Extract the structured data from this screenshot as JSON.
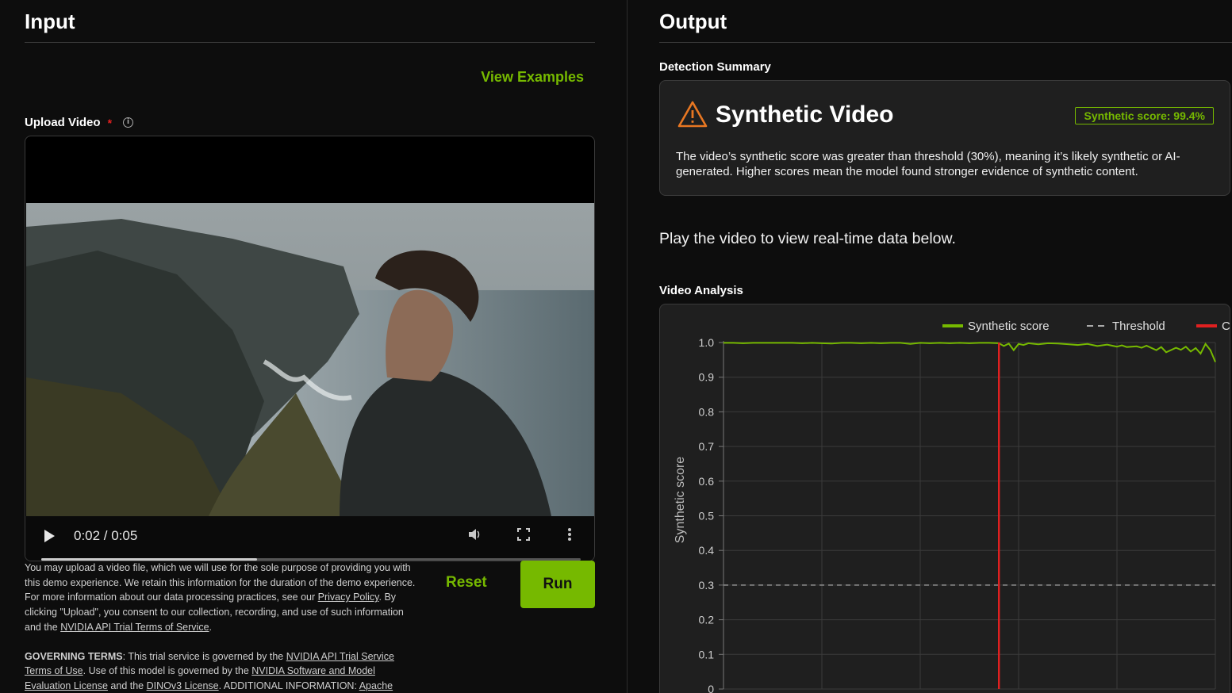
{
  "input": {
    "title": "Input",
    "view_examples": "View Examples",
    "upload_label": "Upload Video",
    "required_mark": "*",
    "info_icon": "info-icon",
    "video": {
      "time": "0:02 / 0:05",
      "progress": 0.4,
      "play_icon": "play-icon",
      "volume_icon": "volume-icon",
      "fullscreen_icon": "fullscreen-icon",
      "more_icon": "more-vertical-icon"
    },
    "disclaimer": {
      "p1_a": "You may upload a video file, which we will use for the sole purpose of providing you with this demo experience. We retain this information for the duration of the demo experience. For more information about our data processing practices, see our ",
      "privacy_link": "Privacy Policy",
      "p1_b": ". By clicking \"Upload\", you consent to our collection, recording, and use of such information and the ",
      "terms_link": "NVIDIA API Trial Terms of Service",
      "p1_c": ".",
      "governing_label": "GOVERNING TERMS",
      "p2_a": ": This trial service is governed by the ",
      "trial_terms_link": "NVIDIA API Trial Service Terms of Use",
      "p2_b": ". Use of this model is governed by the ",
      "software_link": "NVIDIA Software and Model Evaluation License",
      "p2_c": " and the ",
      "dino_link": "DINOv3 License",
      "p2_d": ". ADDITIONAL INFORMATION: ",
      "apache_link": "Apache"
    },
    "reset": "Reset",
    "run": "Run"
  },
  "output": {
    "title": "Output",
    "summary_label": "Detection Summary",
    "result_title": "Synthetic Video",
    "score_badge": "Synthetic score: 99.4%",
    "result_desc": "The video’s synthetic score was greater than threshold (30%), meaning it’s likely synthetic or AI-generated. Higher scores mean the model found stronger evidence of synthetic content.",
    "play_message": "Play the video to view real-time data below.",
    "analysis_label": "Video Analysis",
    "warning_icon": "warning-triangle-icon"
  },
  "colors": {
    "accent": "#76b900",
    "warning": "#e87722",
    "current_time": "#e02020",
    "required": "#e52020"
  },
  "chart_data": {
    "type": "line",
    "ylabel": "Synthetic score",
    "ylim": [
      0,
      1
    ],
    "yticks": [
      "1.0",
      "0.9",
      "0.8",
      "0.7",
      "0.6",
      "0.5",
      "0.4",
      "0.3",
      "0.2",
      "0.1",
      "0"
    ],
    "xlim": [
      0,
      5
    ],
    "grid": true,
    "legend": [
      {
        "name": "Synthetic score",
        "style": "solid",
        "color": "#76b900"
      },
      {
        "name": "Threshold",
        "style": "dashed",
        "color": "#aaaaaa"
      },
      {
        "name": "Current Time",
        "style": "solid",
        "color": "#e02020"
      }
    ],
    "legend_position": "top-right",
    "threshold": 0.3,
    "current_time": 2.8,
    "series": [
      {
        "name": "Synthetic score",
        "x": [
          0,
          0.1,
          0.2,
          0.3,
          0.4,
          0.5,
          0.6,
          0.7,
          0.8,
          0.9,
          1.0,
          1.1,
          1.2,
          1.3,
          1.4,
          1.5,
          1.6,
          1.7,
          1.8,
          1.9,
          2.0,
          2.1,
          2.2,
          2.3,
          2.4,
          2.5,
          2.6,
          2.7,
          2.8,
          2.85,
          2.9,
          2.95,
          3.0,
          3.05,
          3.1,
          3.2,
          3.3,
          3.4,
          3.5,
          3.6,
          3.7,
          3.8,
          3.9,
          4.0,
          4.05,
          4.1,
          4.2,
          4.25,
          4.3,
          4.4,
          4.45,
          4.5,
          4.6,
          4.65,
          4.7,
          4.75,
          4.8,
          4.85,
          4.9,
          4.95,
          5.0
        ],
        "values": [
          0.999,
          0.999,
          0.998,
          0.999,
          0.999,
          0.999,
          0.999,
          0.999,
          0.998,
          0.999,
          0.998,
          0.997,
          0.999,
          0.999,
          0.998,
          0.999,
          0.998,
          0.999,
          0.999,
          0.996,
          0.999,
          0.998,
          0.999,
          0.998,
          0.999,
          0.998,
          0.999,
          0.999,
          0.998,
          0.99,
          0.997,
          0.978,
          0.996,
          0.993,
          0.998,
          0.995,
          0.998,
          0.997,
          0.995,
          0.993,
          0.996,
          0.99,
          0.994,
          0.988,
          0.992,
          0.987,
          0.989,
          0.985,
          0.991,
          0.978,
          0.987,
          0.972,
          0.985,
          0.979,
          0.988,
          0.974,
          0.984,
          0.968,
          0.996,
          0.978,
          0.944
        ]
      }
    ]
  }
}
